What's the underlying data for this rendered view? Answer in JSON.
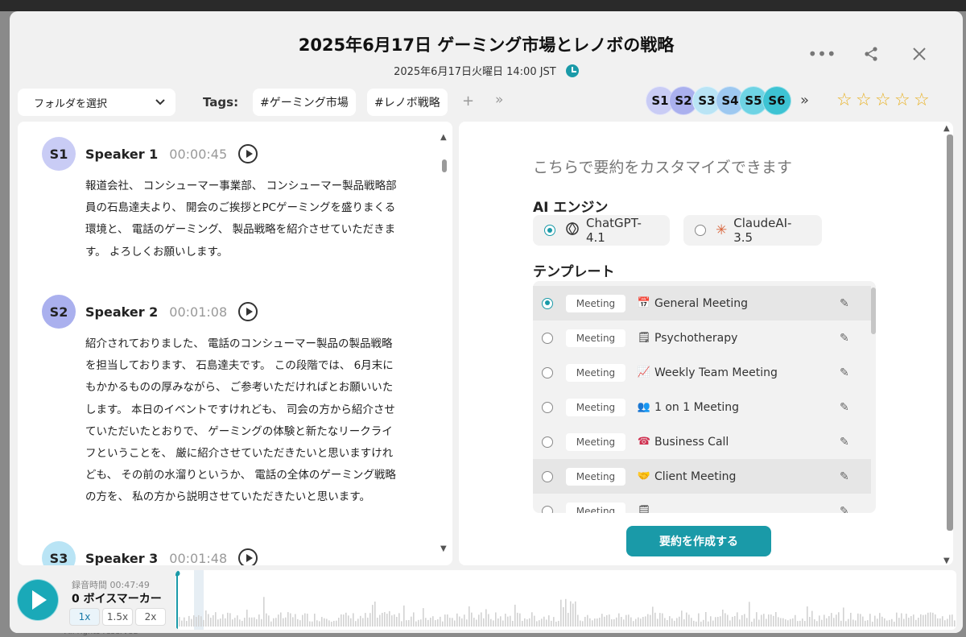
{
  "header": {
    "title": "2025年6月17日 ゲーミング市場とレノボの戦略",
    "datetime": "2025年6月17日火曜日 14:00 JST"
  },
  "toolbar": {
    "folder_label": "フォルダを選択",
    "tags_label": "Tags:",
    "tags": [
      "#ゲーミング市場",
      "#レノボ戦略"
    ],
    "add_tag": "+",
    "more": "»",
    "speakers": [
      "S1",
      "S2",
      "S3",
      "S4",
      "S5",
      "S6"
    ],
    "speaker_colors": [
      "#c9ccf5",
      "#aab0ee",
      "#b9e4f5",
      "#9dc8f0",
      "#6ed3e4",
      "#3dc3d3"
    ],
    "speakers_more": "»",
    "rating": 0,
    "rating_max": 5
  },
  "transcript": {
    "segments": [
      {
        "avatar": "S1",
        "name": "Speaker 1",
        "time": "00:00:45",
        "text": "報道会社、 コンシューマー事業部、 コンシューマー製品戦略部員の石島達夫より、 開会のご挨拶とPCゲーミングを盛りまくる環境と、 電話のゲーミング、 製品戦略を紹介させていただきます。 よろしくお願いします。"
      },
      {
        "avatar": "S2",
        "name": "Speaker 2",
        "time": "00:01:08",
        "text": "紹介されておりました、 電話のコンシューマー製品の製品戦略を担当しております、 石島達夫です。 この段階では、 6月末にもかかるものの厚みながら、 ご参考いただければとお願いいたします。 本日のイベントですけれども、 司会の方から紹介させていただいたとおりで、 ゲーミングの体験と新たなリークライフということを、 厳に紹介させていただきたいと思いますけれども、 その前の水溜りというか、 電話の全体のゲーミング戦略の方を、 私の方から説明させていただきたいと思います。"
      },
      {
        "avatar": "S3",
        "name": "Speaker 3",
        "time": "00:01:48",
        "text": ""
      }
    ]
  },
  "summary": {
    "heading": "こちらで要約をカスタマイズできます",
    "engine_label": "AI エンジン",
    "engines": [
      {
        "label": "ChatGPT-4.1",
        "selected": true
      },
      {
        "label": "ClaudeAI-3.5",
        "selected": false
      }
    ],
    "template_label": "テンプレート",
    "templates": [
      {
        "badge": "Meeting",
        "icon": "calendar-icon",
        "label": "General Meeting",
        "selected": true
      },
      {
        "badge": "Meeting",
        "icon": "notepad-icon",
        "label": "Psychotherapy",
        "selected": false
      },
      {
        "badge": "Meeting",
        "icon": "chart-icon",
        "label": "Weekly Team Meeting",
        "selected": false
      },
      {
        "badge": "Meeting",
        "icon": "people-icon",
        "label": "1 on 1 Meeting",
        "selected": false
      },
      {
        "badge": "Meeting",
        "icon": "telephone-icon",
        "label": "Business Call",
        "selected": false
      },
      {
        "badge": "Meeting",
        "icon": "handshake-icon",
        "label": "Client Meeting",
        "selected": false
      },
      {
        "badge": "Meeting",
        "icon": "doc-icon",
        "label": "",
        "selected": false
      }
    ],
    "create_button": "要約を作成する"
  },
  "player": {
    "rec_time": "録音時間 00:47:49",
    "voice_markers": "0 ボイスマーカー",
    "speeds": [
      "1x",
      "1.5x",
      "2x"
    ],
    "speed_selected": "1x",
    "progress": 0.0
  },
  "footer": {
    "text": "All rights reserved"
  },
  "colors": {
    "accent": "#1a9aa8",
    "star": "#e8b020"
  }
}
